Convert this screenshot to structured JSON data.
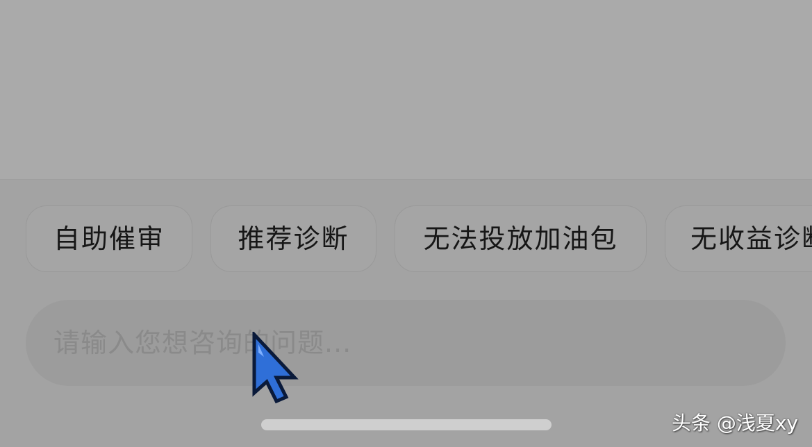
{
  "quick_actions": [
    {
      "label": "自助催审"
    },
    {
      "label": "推荐诊断"
    },
    {
      "label": "无法投放加油包"
    },
    {
      "label": "无收益诊断"
    }
  ],
  "input": {
    "placeholder": "请输入您想咨询的问题..."
  },
  "watermark": {
    "text": "头条 @浅夏xy"
  },
  "icons": {
    "cursor": "arrow-cursor-icon"
  },
  "colors": {
    "cursor_fill": "#2f6fd8",
    "cursor_outline": "#0a1a3a"
  }
}
